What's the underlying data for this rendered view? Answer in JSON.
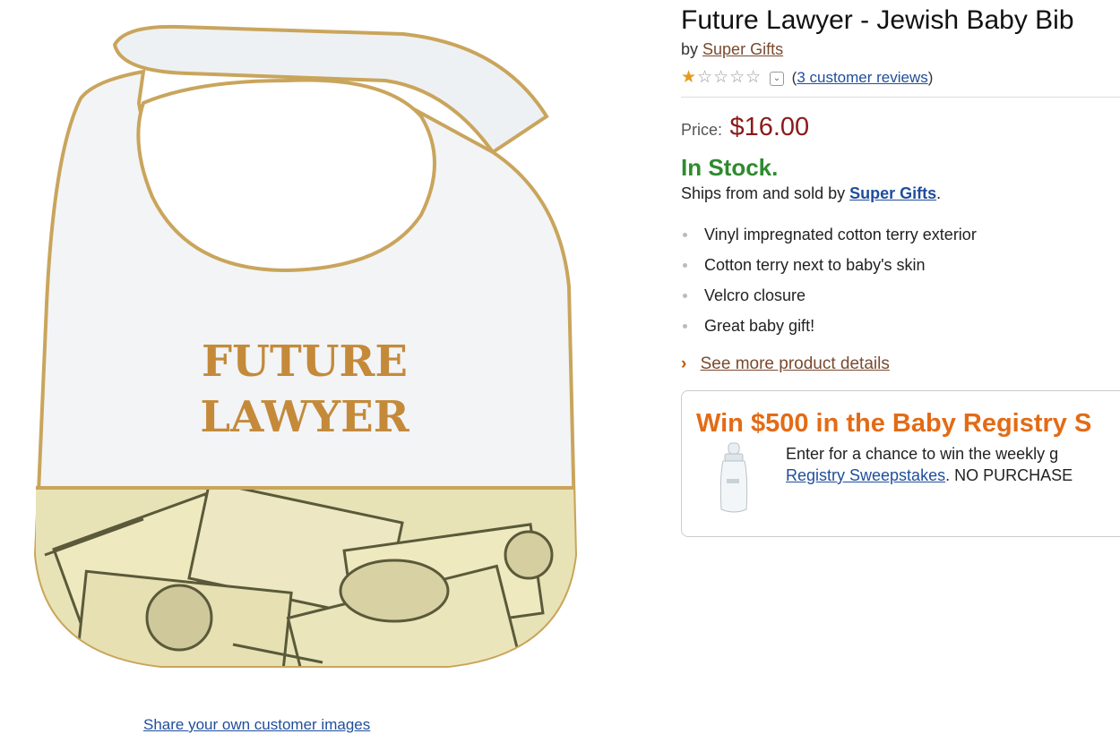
{
  "image": {
    "bib_text_line1": "FUTURE",
    "bib_text_line2": "LAWYER"
  },
  "share_images_link": "Share your own customer images",
  "product": {
    "title": "Future Lawyer - Jewish Baby Bib",
    "by_prefix": "by",
    "brand": "Super Gifts",
    "rating_value": 1,
    "rating_max": 5,
    "reviews_link": "3 customer reviews",
    "price_label": "Price:",
    "price": "$16.00",
    "stock_status": "In Stock.",
    "ships_prefix": "Ships from and sold by",
    "seller": "Super Gifts",
    "ships_suffix": ".",
    "bullets": [
      "Vinyl impregnated cotton terry exterior",
      "Cotton terry next to baby's skin",
      "Velcro closure",
      "Great baby gift!"
    ],
    "more_details_link": "See more product details"
  },
  "promo": {
    "title": "Win $500 in the Baby Registry S",
    "line1": "Enter for a chance to win the weekly g",
    "link": "Registry Sweepstakes",
    "line2_suffix": ". NO PURCHASE"
  },
  "colors": {
    "price": "#8b1a1a",
    "in_stock": "#2e8b2e",
    "promo_title": "#e36b16",
    "link": "#1f4e9b",
    "brand_link": "#7a4a2f"
  }
}
